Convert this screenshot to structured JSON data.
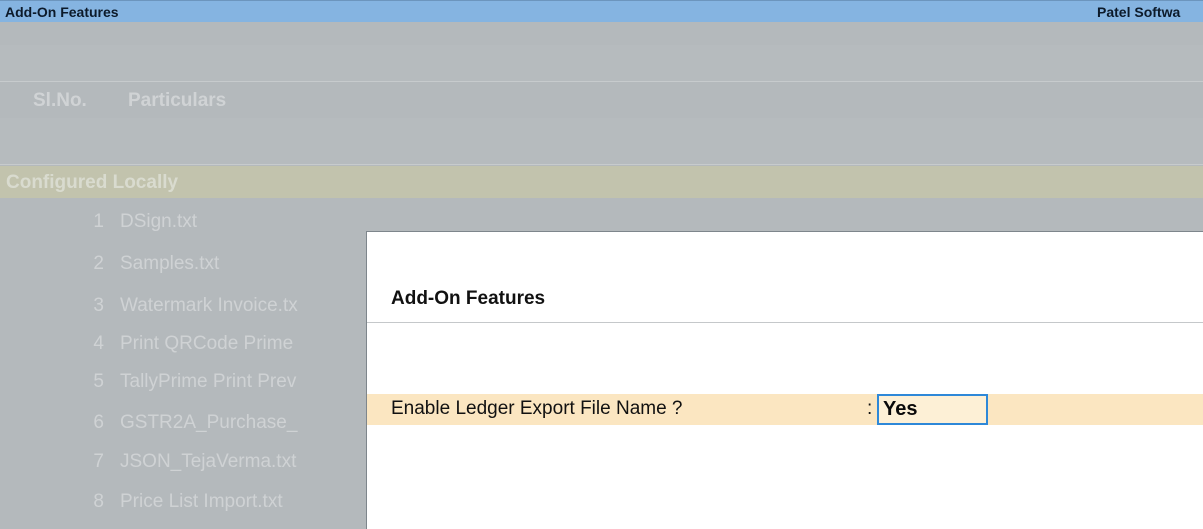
{
  "titlebar": {
    "title": "Add-On Features",
    "company": "Patel Softwa"
  },
  "columns": {
    "slno": "Sl.No.",
    "particulars": "Particulars"
  },
  "section": {
    "title": "Configured Locally"
  },
  "items": [
    {
      "no": "1",
      "name": "DSign.txt"
    },
    {
      "no": "2",
      "name": "Samples.txt"
    },
    {
      "no": "3",
      "name": "Watermark Invoice.tx"
    },
    {
      "no": "4",
      "name": "Print QRCode Prime"
    },
    {
      "no": "5",
      "name": "TallyPrime Print Prev"
    },
    {
      "no": "6",
      "name": "GSTR2A_Purchase_"
    },
    {
      "no": "7",
      "name": "JSON_TejaVerma.txt"
    },
    {
      "no": "8",
      "name": "Price List Import.txt"
    }
  ],
  "dialog": {
    "title": "Add-On Features",
    "field_label": "Enable Ledger Export File Name ?",
    "colon": ":",
    "field_value": "Yes"
  },
  "colors": {
    "titlebar": "#85b4e1",
    "section": "#c2c3ad",
    "field_row": "#fbe6c1",
    "focus": "#2e88d8"
  }
}
